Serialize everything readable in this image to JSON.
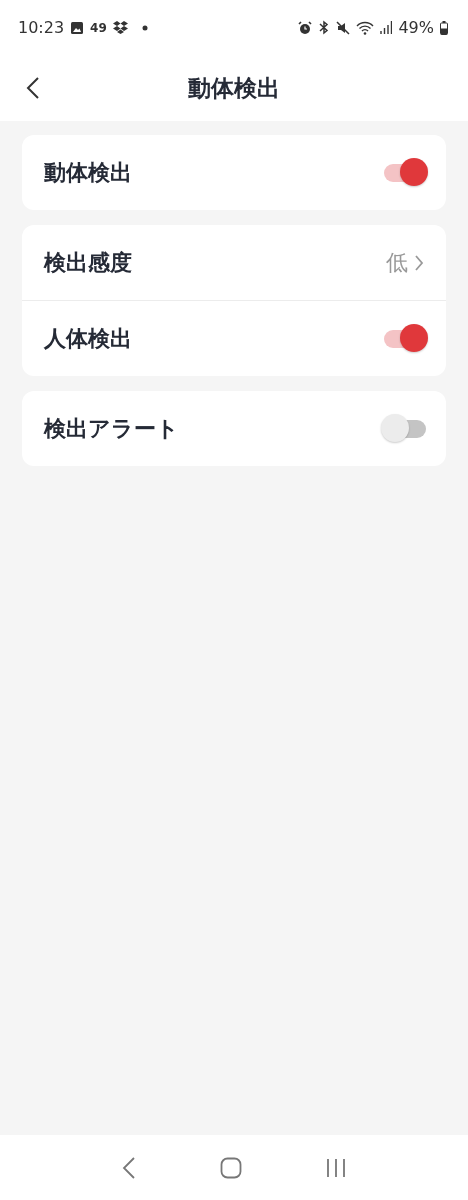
{
  "status_bar": {
    "time": "10:23",
    "notification_count": "49",
    "battery": "49%"
  },
  "header": {
    "title": "動体検出"
  },
  "groups": [
    {
      "rows": [
        {
          "kind": "toggle",
          "label": "動体検出",
          "on": true
        }
      ]
    },
    {
      "rows": [
        {
          "kind": "value",
          "label": "検出感度",
          "value": "低"
        },
        {
          "kind": "toggle",
          "label": "人体検出",
          "on": true
        }
      ]
    },
    {
      "rows": [
        {
          "kind": "toggle",
          "label": "検出アラート",
          "on": false
        }
      ]
    }
  ]
}
